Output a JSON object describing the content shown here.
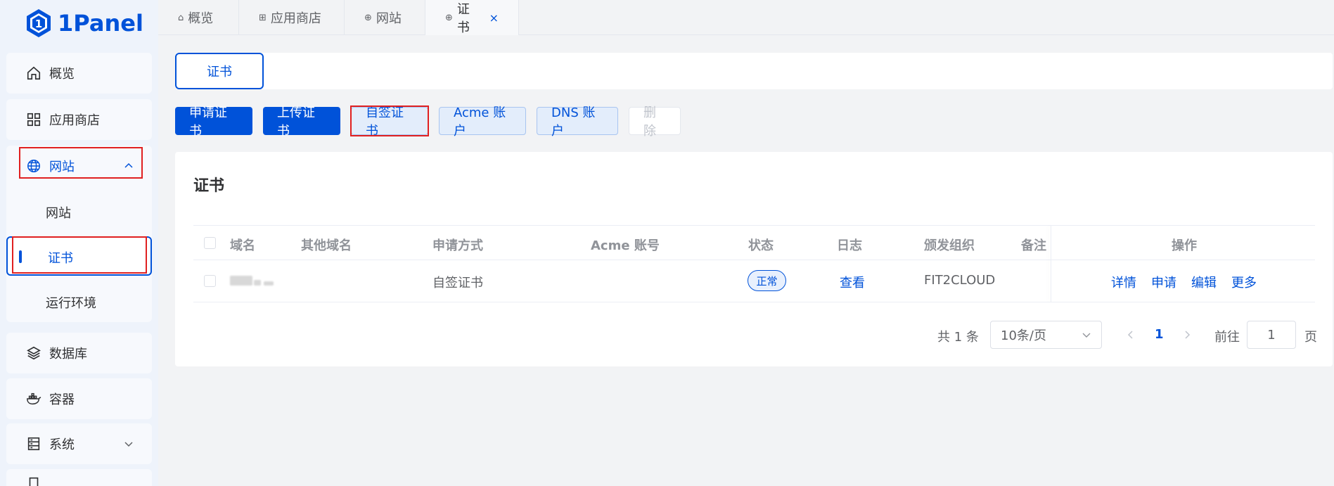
{
  "brand": {
    "name": "1Panel",
    "accent": "#0052d9"
  },
  "sidebar": {
    "items": [
      {
        "label": "概览",
        "icon": "home-icon"
      },
      {
        "label": "应用商店",
        "icon": "grid-icon"
      },
      {
        "label": "网站",
        "icon": "globe-icon"
      },
      {
        "label": "数据库",
        "icon": "layers-icon"
      },
      {
        "label": "容器",
        "icon": "docker-icon"
      },
      {
        "label": "系统",
        "icon": "server-icon"
      }
    ],
    "website_sub": [
      "网站",
      "证书",
      "运行环境"
    ]
  },
  "tabs": [
    {
      "label": "概览"
    },
    {
      "label": "应用商店"
    },
    {
      "label": "网站"
    },
    {
      "label": "证书",
      "active": true
    }
  ],
  "subtab": {
    "label": "证书"
  },
  "toolbar": {
    "apply": "申请证书",
    "upload": "上传证书",
    "selfsign": "自签证书",
    "acme": "Acme 账户",
    "dns": "DNS 账户",
    "delete": "删除"
  },
  "card": {
    "title": "证书"
  },
  "table": {
    "headers": [
      "域名",
      "其他域名",
      "申请方式",
      "Acme 账号",
      "状态",
      "日志",
      "颁发组织",
      "备注",
      "操作"
    ],
    "rows": [
      {
        "method": "自签证书",
        "status": "正常",
        "log": "查看",
        "issuer": "FIT2CLOUD",
        "actions": [
          "详情",
          "申请",
          "编辑",
          "更多"
        ]
      }
    ]
  },
  "pagination": {
    "total": "共 1 条",
    "page_size": "10条/页",
    "current": "1",
    "goto_label": "前往",
    "goto_value": "1",
    "page_suffix": "页"
  }
}
